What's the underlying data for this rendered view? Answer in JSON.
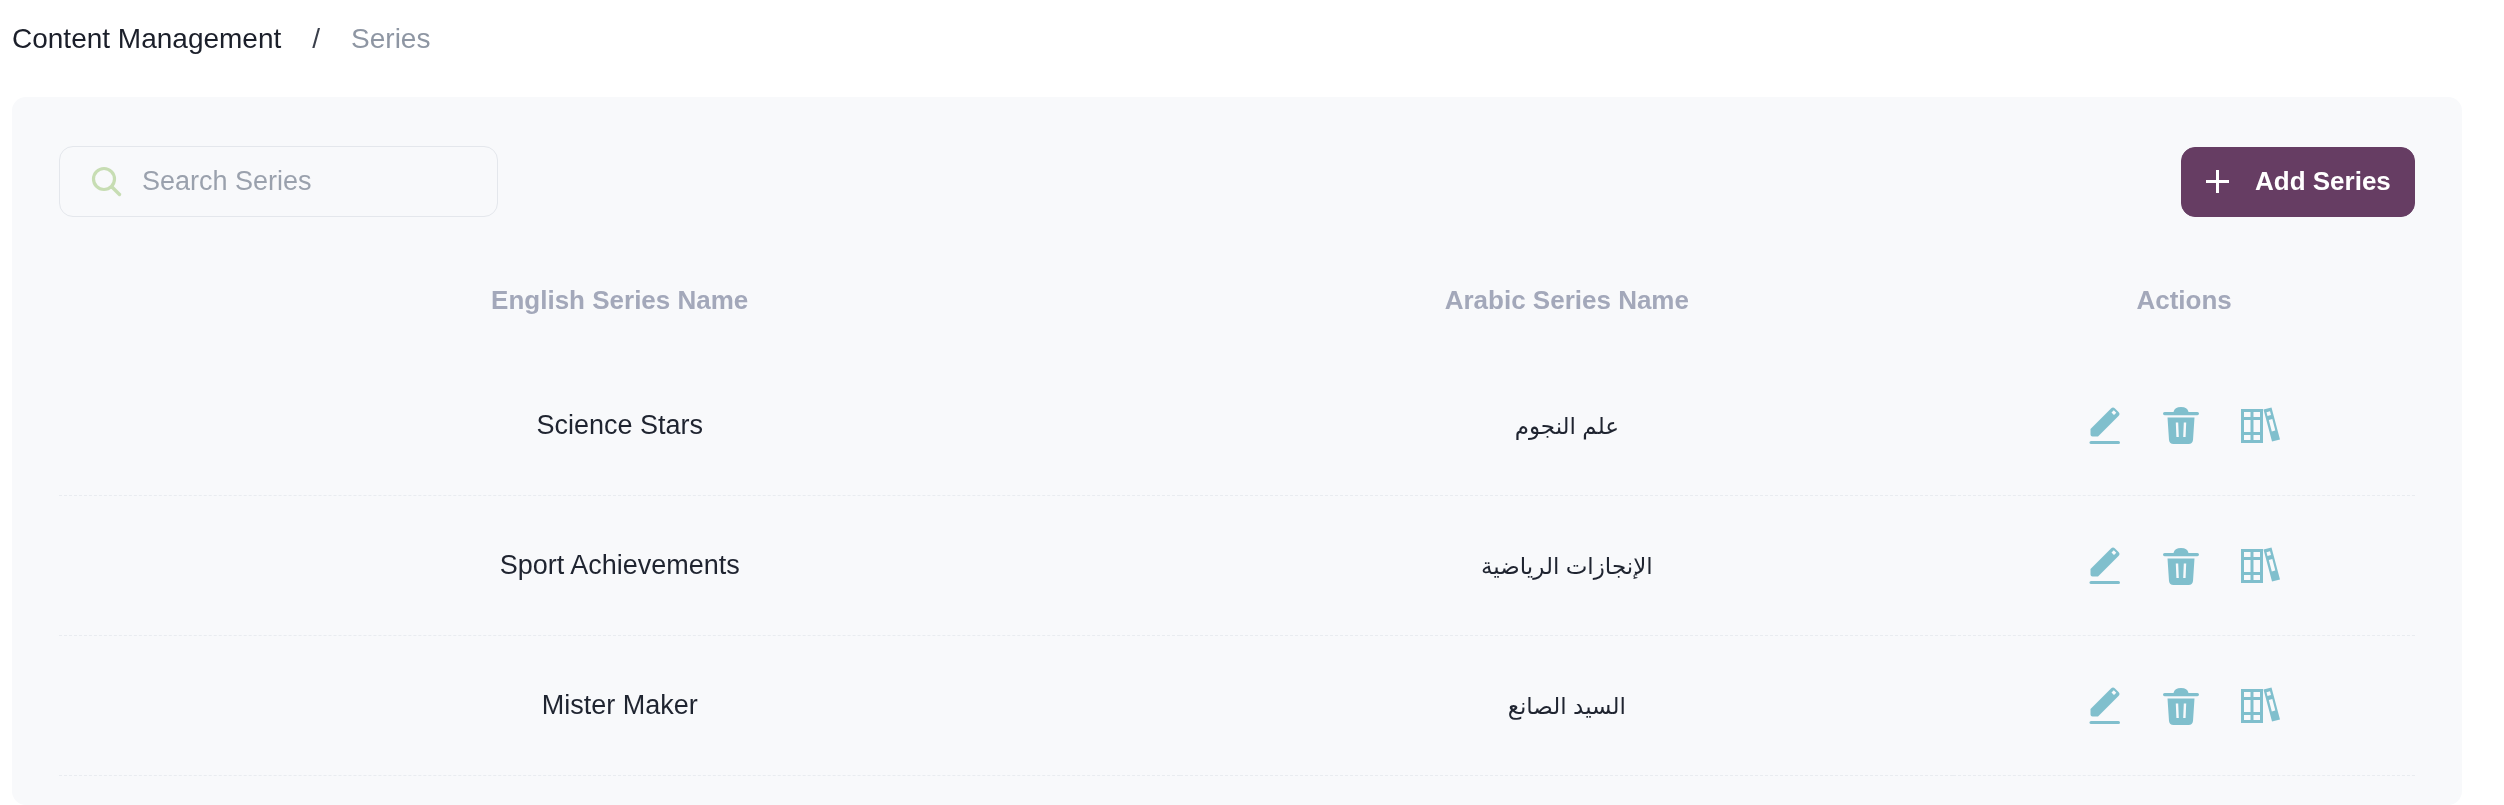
{
  "breadcrumb": {
    "separator": "/",
    "items": [
      {
        "label": "Content Management",
        "current": false
      },
      {
        "label": "Series",
        "current": true
      }
    ]
  },
  "search": {
    "placeholder": "Search Series"
  },
  "add_button": {
    "label": "Add Series"
  },
  "table": {
    "columns": [
      "English Series Name",
      "Arabic Series Name",
      "Actions"
    ],
    "rows": [
      {
        "english_name": "Science Stars",
        "arabic_name": "علم النجوم"
      },
      {
        "english_name": "Sport Achievements",
        "arabic_name": "الإنجازات الرياضية"
      },
      {
        "english_name": "Mister Maker",
        "arabic_name": "السيد الصانع"
      }
    ]
  }
}
